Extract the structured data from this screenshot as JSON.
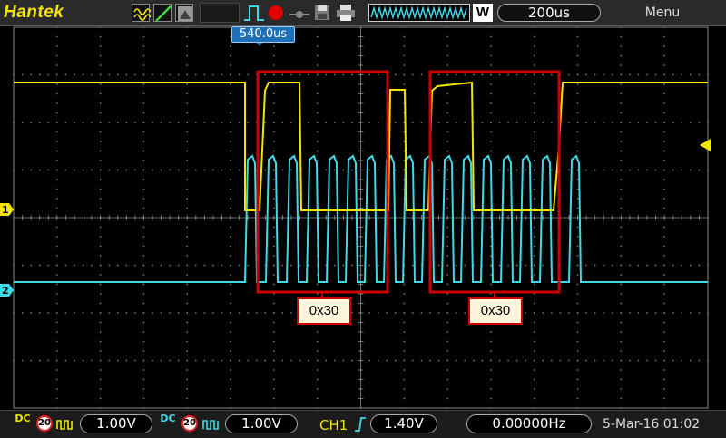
{
  "header": {
    "brand": "Hantek",
    "trigger_position": "540.0us",
    "timebase": "200us",
    "menu_label": "Menu",
    "window_mode_badge": "W"
  },
  "annotations": [
    {
      "label": "0x30"
    },
    {
      "label": "0x30"
    }
  ],
  "channels": {
    "ch1": {
      "marker": "1",
      "color": "#f2e600",
      "coupling": "DC",
      "bandwidth_limit": "20",
      "volts_per_div": "1.00V"
    },
    "ch2": {
      "marker": "2",
      "color": "#3fd9e8",
      "coupling": "DC",
      "bandwidth_limit": "20",
      "volts_per_div": "1.00V"
    }
  },
  "trigger": {
    "source": "CH1",
    "slope": "rising-edge-icon",
    "level": "1.40V",
    "frequency": "0.00000Hz"
  },
  "status": {
    "datetime": "5-Mar-16 01:02"
  },
  "icons": [
    "yellow-wave-icon",
    "ramp-icon",
    "persist-icon",
    "single-pulse-icon",
    "record-icon",
    "reference-icon",
    "save-icon",
    "print-icon",
    "wave-memory-icon",
    "trigger-level-arrow-icon"
  ],
  "colors": {
    "grid": "#8a8a8a",
    "annotation_box": "#cc0000",
    "annotation_fill": "#fff5dc",
    "header_bg": "#2a2a2a"
  }
}
